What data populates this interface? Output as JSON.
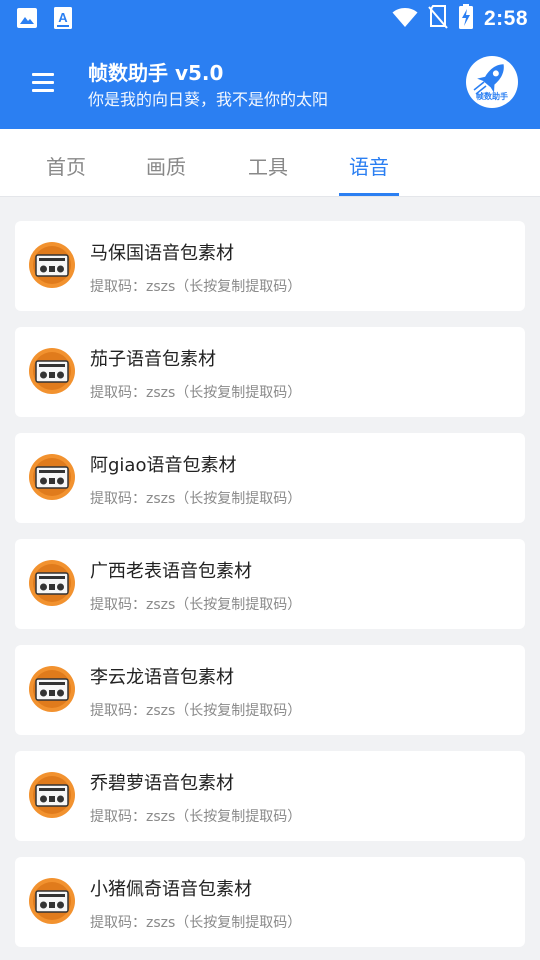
{
  "status_bar": {
    "time": "2:58",
    "left_icons": [
      "image-icon",
      "a-notification-icon"
    ],
    "right_icons": [
      "wifi-icon",
      "no-sim-icon",
      "battery-charging-icon"
    ]
  },
  "app_bar": {
    "title": "帧数助手 v5.0",
    "subtitle": "你是我的向日葵，我不是你的太阳",
    "logo_text": "帧数助手",
    "accent_color": "#2b7ff2"
  },
  "tabs": [
    {
      "label": "首页",
      "active": false
    },
    {
      "label": "画质",
      "active": false
    },
    {
      "label": "工具",
      "active": false
    },
    {
      "label": "语音",
      "active": true
    }
  ],
  "items": [
    {
      "title": "马保国语音包素材",
      "subtitle": "提取码：zszs（长按复制提取码）",
      "icon": "radio-icon"
    },
    {
      "title": "茄子语音包素材",
      "subtitle": "提取码：zszs（长按复制提取码）",
      "icon": "radio-icon"
    },
    {
      "title": "阿giao语音包素材",
      "subtitle": "提取码：zszs（长按复制提取码）",
      "icon": "radio-icon"
    },
    {
      "title": "广西老表语音包素材",
      "subtitle": "提取码：zszs（长按复制提取码）",
      "icon": "radio-icon"
    },
    {
      "title": "李云龙语音包素材",
      "subtitle": "提取码：zszs（长按复制提取码）",
      "icon": "radio-icon"
    },
    {
      "title": "乔碧萝语音包素材",
      "subtitle": "提取码：zszs（长按复制提取码）",
      "icon": "radio-icon"
    },
    {
      "title": "小猪佩奇语音包素材",
      "subtitle": "提取码：zszs（长按复制提取码）",
      "icon": "radio-icon"
    }
  ]
}
